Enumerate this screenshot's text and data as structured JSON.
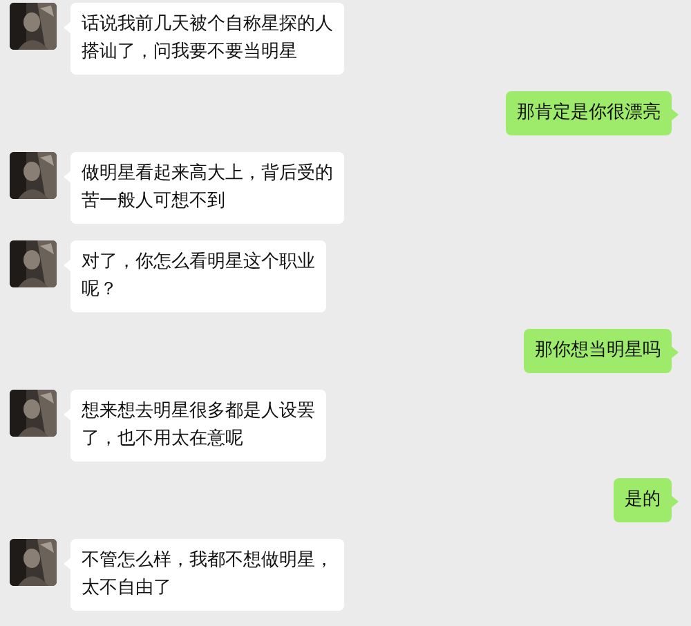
{
  "messages": [
    {
      "kind": "received",
      "lines": [
        "话说我前几天被个自称星探的人",
        "搭讪了，问我要不要当明星"
      ]
    },
    {
      "kind": "sent",
      "lines": [
        "那肯定是你很漂亮"
      ]
    },
    {
      "kind": "received",
      "lines": [
        "做明星看起来高大上，背后受的",
        "苦一般人可想不到"
      ]
    },
    {
      "kind": "received",
      "lines": [
        "对了，你怎么看明星这个职业",
        "呢？"
      ]
    },
    {
      "kind": "sent",
      "lines": [
        "那你想当明星吗"
      ]
    },
    {
      "kind": "received",
      "lines": [
        "想来想去明星很多都是人设罢",
        "了，也不用太在意呢"
      ]
    },
    {
      "kind": "sent",
      "lines": [
        "是的"
      ]
    },
    {
      "kind": "received",
      "lines": [
        "不管怎么样，我都不想做明星，",
        "太不自由了"
      ]
    }
  ]
}
